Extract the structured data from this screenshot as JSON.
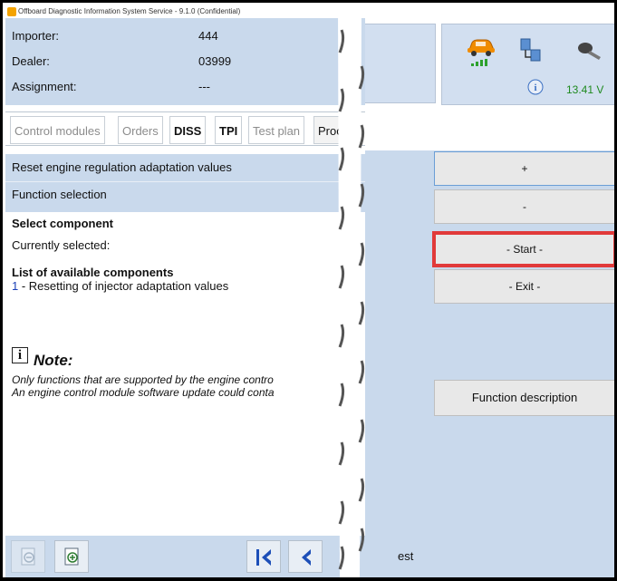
{
  "window": {
    "title": "Offboard Diagnostic Information System Service - 9.1.0 (Confidential)"
  },
  "info": {
    "importer_label": "Importer:",
    "importer_value": "444",
    "dealer_label": "Dealer:",
    "dealer_value": "03999",
    "assignment_label": "Assignment:",
    "assignment_value": "---"
  },
  "tabs": [
    "Control modules",
    "Orders",
    "DISS",
    "TPI",
    "Test plan",
    "Proc"
  ],
  "header": {
    "title": "Reset engine regulation adaptation values",
    "subtitle": "Function selection"
  },
  "content": {
    "select_component": "Select component",
    "currently_selected": "Currently selected:",
    "list_title": "List of available components",
    "item_number": "1",
    "item_text": " - Resetting of injector adaptation values"
  },
  "note": {
    "title": "Note:",
    "line1": "Only functions that are supported by the engine contro",
    "line2": "An engine control module software update could conta"
  },
  "status": {
    "voltage": "13.41 V"
  },
  "buttons": {
    "plus": "+",
    "minus": "-",
    "start": "- Start -",
    "exit": "- Exit -",
    "function_description": "Function description",
    "test_partial": "est"
  },
  "colors": {
    "panel": "#c9d9ec",
    "highlight": "#e13a3a",
    "voltage": "#1f8a1f"
  },
  "icons": [
    "car-icon",
    "network-icon",
    "key-icon",
    "info-icon",
    "note-icon",
    "zoom-out-icon",
    "zoom-in-icon",
    "first-page-icon",
    "previous-page-icon"
  ]
}
